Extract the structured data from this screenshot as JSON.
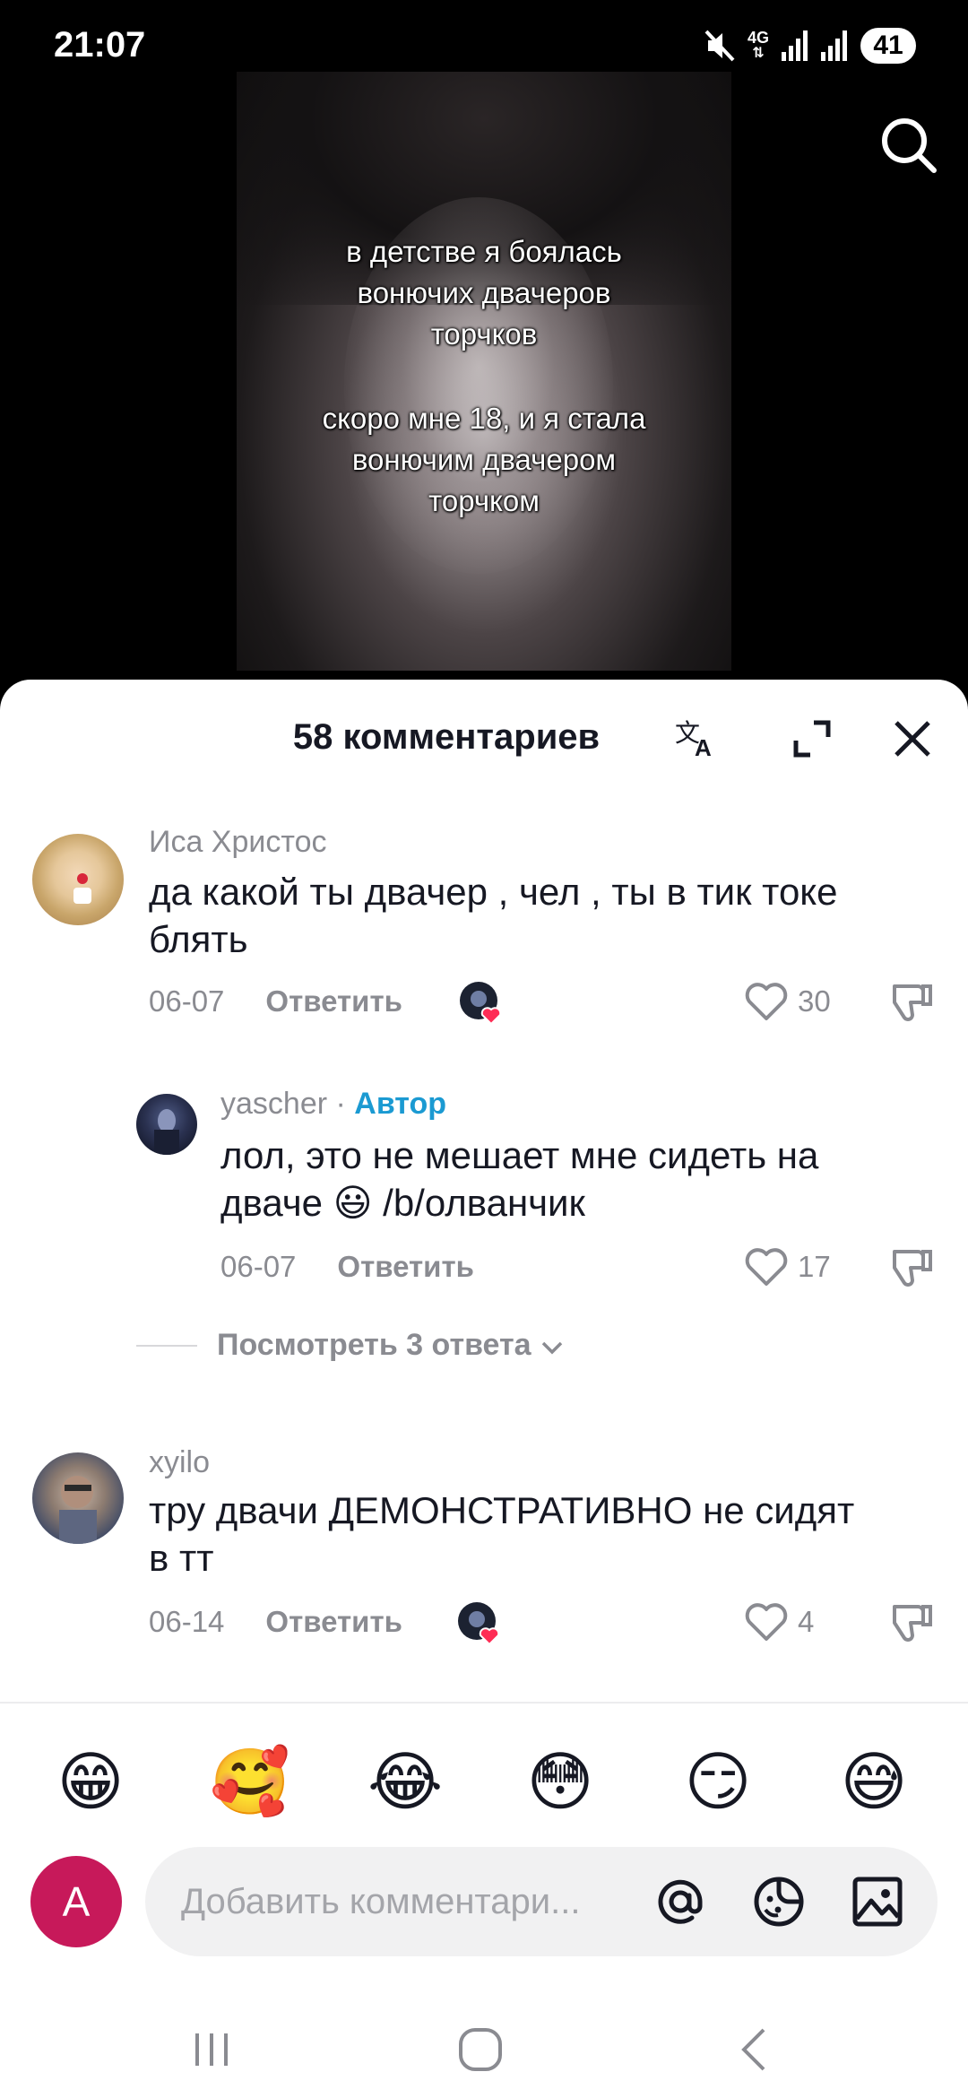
{
  "status_bar": {
    "time": "21:07",
    "network": "4G",
    "battery": "41",
    "icons": [
      "mute-icon",
      "4g-icon",
      "signal-icon",
      "signal-icon",
      "battery-icon"
    ]
  },
  "video": {
    "caption_line1": "в детстве я боялась",
    "caption_line2": "вонючих двачеров",
    "caption_line3": "торчков",
    "caption_line4": "скоро мне 18, и я стала",
    "caption_line5": "вонючим двачером",
    "caption_line6": "торчком"
  },
  "comments_sheet": {
    "title": "58 комментариев",
    "icons": [
      "translate-icon",
      "expand-icon",
      "close-icon"
    ]
  },
  "comments": [
    {
      "user": "Иса Христос",
      "text_line1": "да какой ты двачер , чел , ты в тик токе",
      "text_line2": "блять",
      "date": "06-07",
      "reply_label": "Ответить",
      "likes": "30"
    },
    {
      "user": "yascher",
      "separator": " · ",
      "badge": "Автор",
      "text_line1": "лол, это не мешает мне сидеть на",
      "text_line2": "дваче 😃 /b/олванчик",
      "date": "06-07",
      "reply_label": "Ответить",
      "likes": "17"
    },
    {
      "user": "xyilo",
      "text_line1": "тру двачи ДЕМОНСТРАТИВНО не сидят",
      "text_line2": "в тт",
      "date": "06-14",
      "reply_label": "Ответить",
      "likes": "4"
    }
  ],
  "view_replies": "Посмотреть 3 ответа",
  "emoji_bar": [
    "😁",
    "🥰",
    "😂",
    "😳",
    "😏",
    "😅"
  ],
  "composer": {
    "avatar_letter": "A",
    "placeholder": "Добавить комментари...",
    "icons": [
      "mention-icon",
      "emoji-sticker-icon",
      "image-icon"
    ]
  },
  "colors": {
    "author_badge": "#1b9ad2",
    "avatar_bg": "#c7195a",
    "like_heart": "#fe2c55"
  }
}
